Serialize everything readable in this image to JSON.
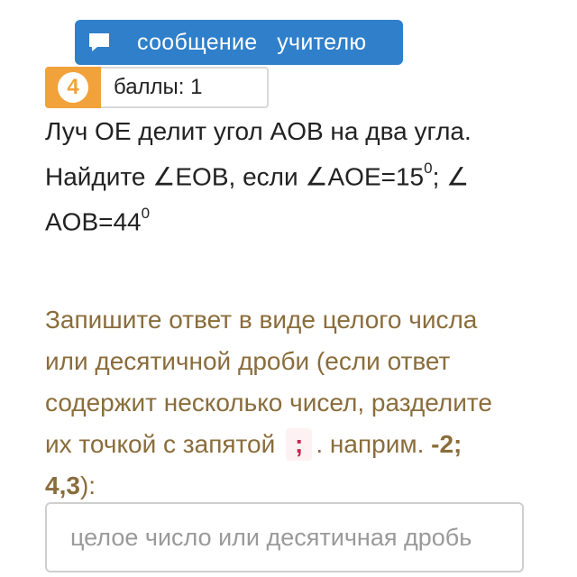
{
  "message_button": {
    "label": "сообщение   учителю",
    "icon": "chat-bubble-icon"
  },
  "score": {
    "number": "4",
    "label": "баллы: 1"
  },
  "question": {
    "line1": "Луч OE делит угол AOB на два угла.",
    "line2a": "Найдите ∠EOB, если ∠AOE=15",
    "sup1": "0",
    "line2b": "; ∠ AOB=44",
    "sup2": "0"
  },
  "instruction": {
    "text1": "Запишите ответ в виде целого числа или десятичной дроби (если ответ содержит несколько чисел, разделите их точкой с запятой ",
    "code": ";",
    "text2": ". наприм. ",
    "example": "-2; 4,3",
    "text3": "):"
  },
  "answer_input": {
    "placeholder": "целое число или десятичная дробь",
    "value": ""
  },
  "colors": {
    "button": "#2f7fca",
    "badge": "#f2a23a",
    "instruction": "#8a6d3b",
    "code": "#c7254e"
  }
}
